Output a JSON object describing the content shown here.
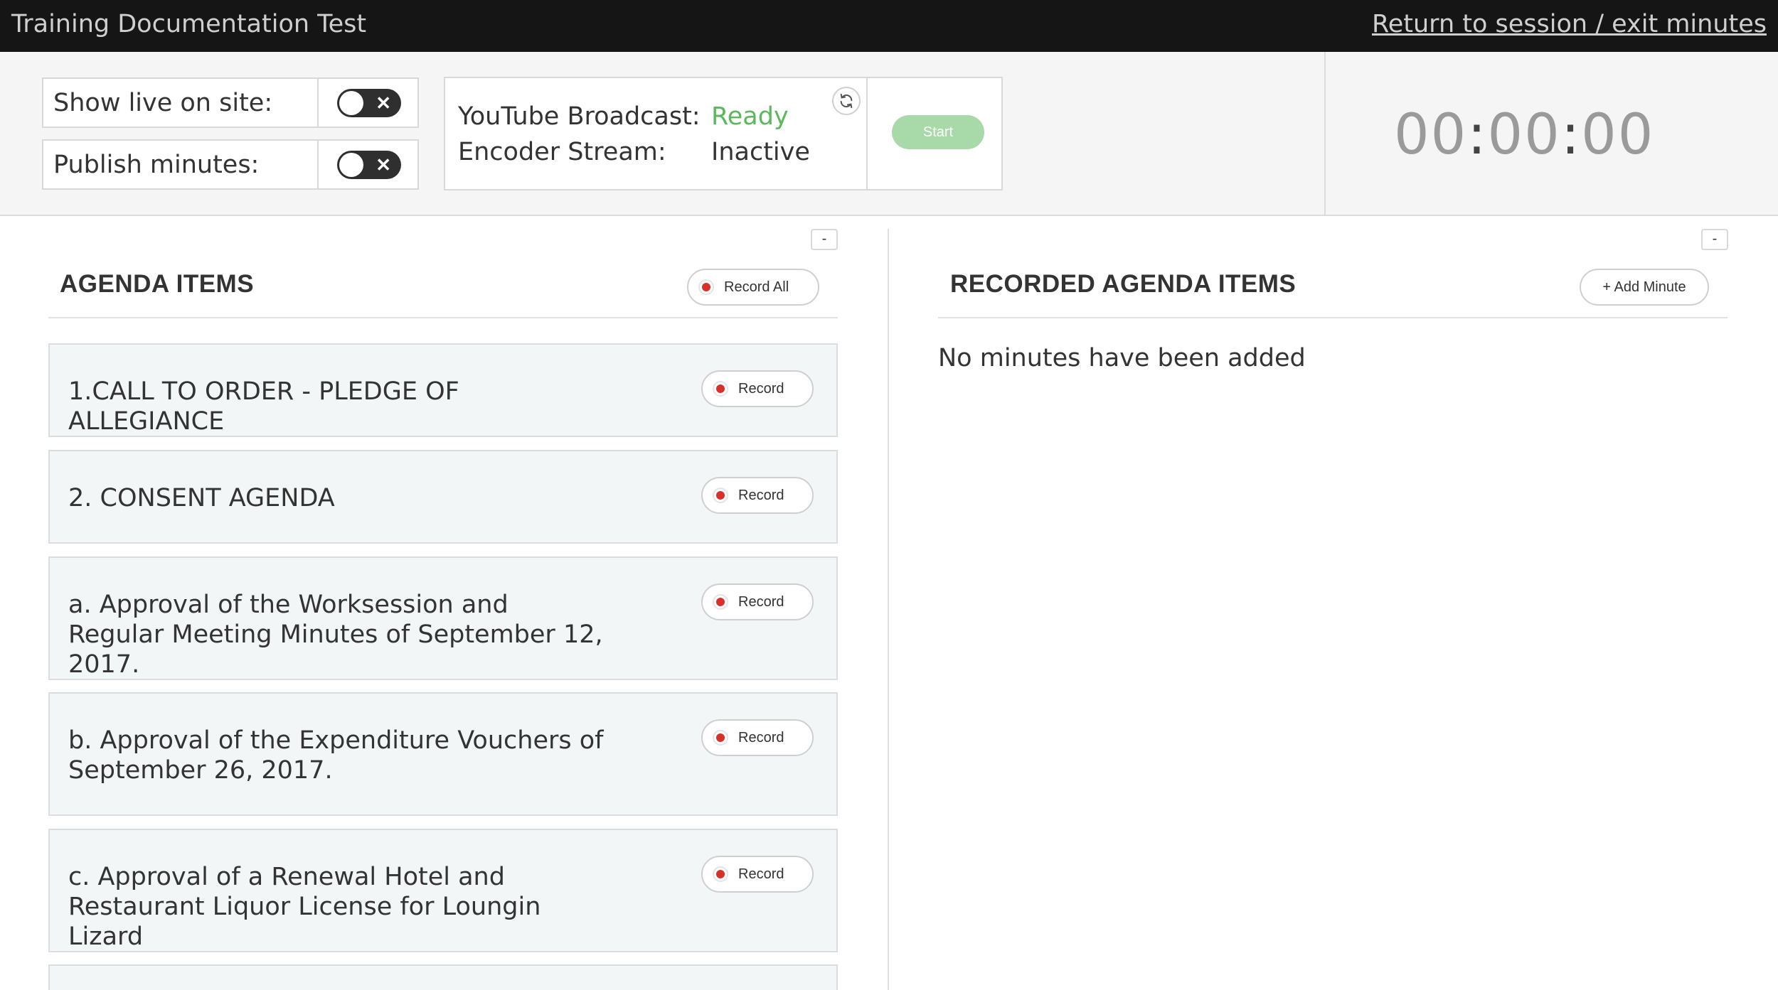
{
  "header": {
    "title": "Training Documentation Test",
    "exit_link": "Return to session / exit minutes"
  },
  "controls": {
    "show_live_label": "Show live on site:",
    "show_live_on": false,
    "publish_label": "Publish minutes:",
    "publish_on": false,
    "youtube_label": "YouTube Broadcast:",
    "youtube_status": "Ready",
    "encoder_label": "Encoder Stream:",
    "encoder_status": "Inactive",
    "start_label": "Start",
    "status_colors": {
      "ready": "#5cb85c",
      "inactive": "#333333"
    }
  },
  "timer": {
    "hours": "00",
    "minutes": "00",
    "seconds": "00"
  },
  "agenda": {
    "heading": "AGENDA ITEMS",
    "collapse_label": "-",
    "record_all_label": "Record All",
    "items": [
      {
        "text": "1.CALL TO ORDER - PLEDGE OF ALLEGIANCE",
        "record_label": "Record"
      },
      {
        "text": "2. CONSENT AGENDA",
        "record_label": "Record"
      },
      {
        "text": "a. Approval of the Worksession and Regular Meeting Minutes of September 12, 2017.",
        "record_label": "Record"
      },
      {
        "text": "b. Approval of the Expenditure Vouchers of September 26, 2017.",
        "record_label": "Record"
      },
      {
        "text": "c. Approval of a Renewal Hotel and Restaurant Liquor License for Loungin Lizard",
        "record_label": "Record"
      }
    ]
  },
  "recorded": {
    "heading": "RECORDED AGENDA ITEMS",
    "collapse_label": "-",
    "add_minute_label": "+ Add Minute",
    "empty_message": "No minutes have been added"
  },
  "icons": {
    "refresh": "refresh-icon",
    "record": "record-dot-icon",
    "toggle_off": "close-icon"
  }
}
